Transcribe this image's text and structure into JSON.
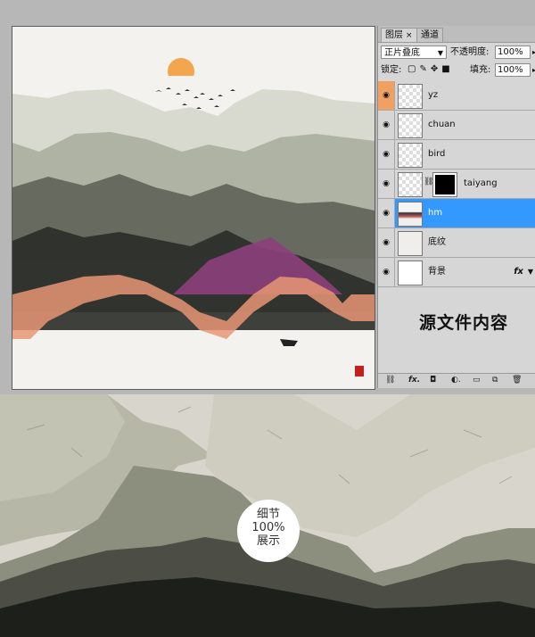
{
  "panel": {
    "tabs": [
      {
        "label": "图层"
      },
      {
        "label": "通道"
      }
    ],
    "tab_close": "×",
    "blend_mode": "正片叠底",
    "opacity_label": "不透明度:",
    "opacity_value": "100%",
    "lock_label": "锁定:",
    "fill_label": "填充:",
    "fill_value": "100%",
    "layers": [
      {
        "name": "yz"
      },
      {
        "name": "chuan"
      },
      {
        "name": "bird"
      },
      {
        "name": "taiyang"
      },
      {
        "name": "hm"
      },
      {
        "name": "底纹"
      },
      {
        "name": "背景",
        "fx": "fx"
      }
    ],
    "note": "源文件内容"
  },
  "detail": {
    "badge_line1": "细节",
    "badge_line2": "100%",
    "badge_line3": "展示"
  },
  "colors": {
    "selected_layer": "#3399ff",
    "sun": "#f4a64e",
    "accent_orange": "#f0a060"
  }
}
